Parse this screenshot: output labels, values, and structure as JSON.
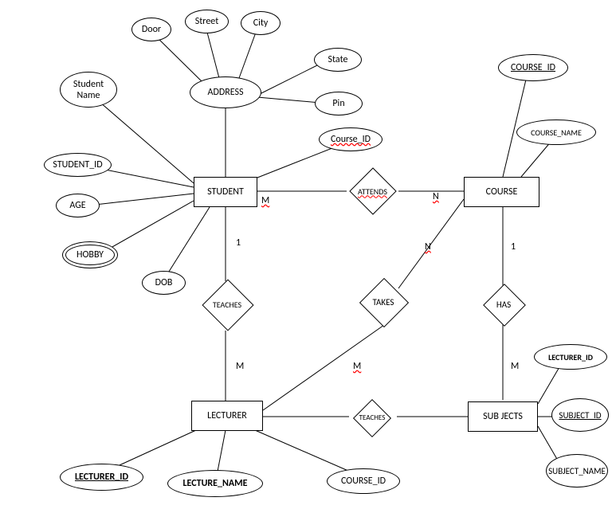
{
  "entities": {
    "student": "STUDENT",
    "course": "COURSE",
    "lecturer": "LECTURER",
    "subjects": "SUB JECTS",
    "address": "ADDRESS"
  },
  "relationships": {
    "attends": "ATTENDS",
    "teaches1": "TEACHES",
    "teaches2": "TEACHES",
    "takes": "TAKES",
    "has": "HAS"
  },
  "attributes": {
    "door": "Door",
    "street": "Street",
    "city": "City",
    "state": "State",
    "pin": "Pin",
    "student_name": "Student Name",
    "student_id": "STUDENT_ID",
    "age": "AGE",
    "hobby": "HOBBY",
    "dob": "DOB",
    "course_fk": "Course_ID",
    "course_id": "COURSE_ID",
    "course_name": "COURSE_NAME",
    "lecturer_id_top": "LECTURER_ID",
    "subject_id": "SUBJECT_ID",
    "subject_name": "SUBJECT_NAME",
    "lecturer_id": "LECTURER_ID",
    "lecture_name": "LECTURE_NAME",
    "lecturer_course_id": "COURSE_ID"
  },
  "cardinality": {
    "stu_attends": "M",
    "course_attends": "N",
    "stu_teaches": "1",
    "lect_teaches": "M",
    "takes_n": "N",
    "takes_m": "M",
    "has_1": "1",
    "has_m": "M"
  }
}
